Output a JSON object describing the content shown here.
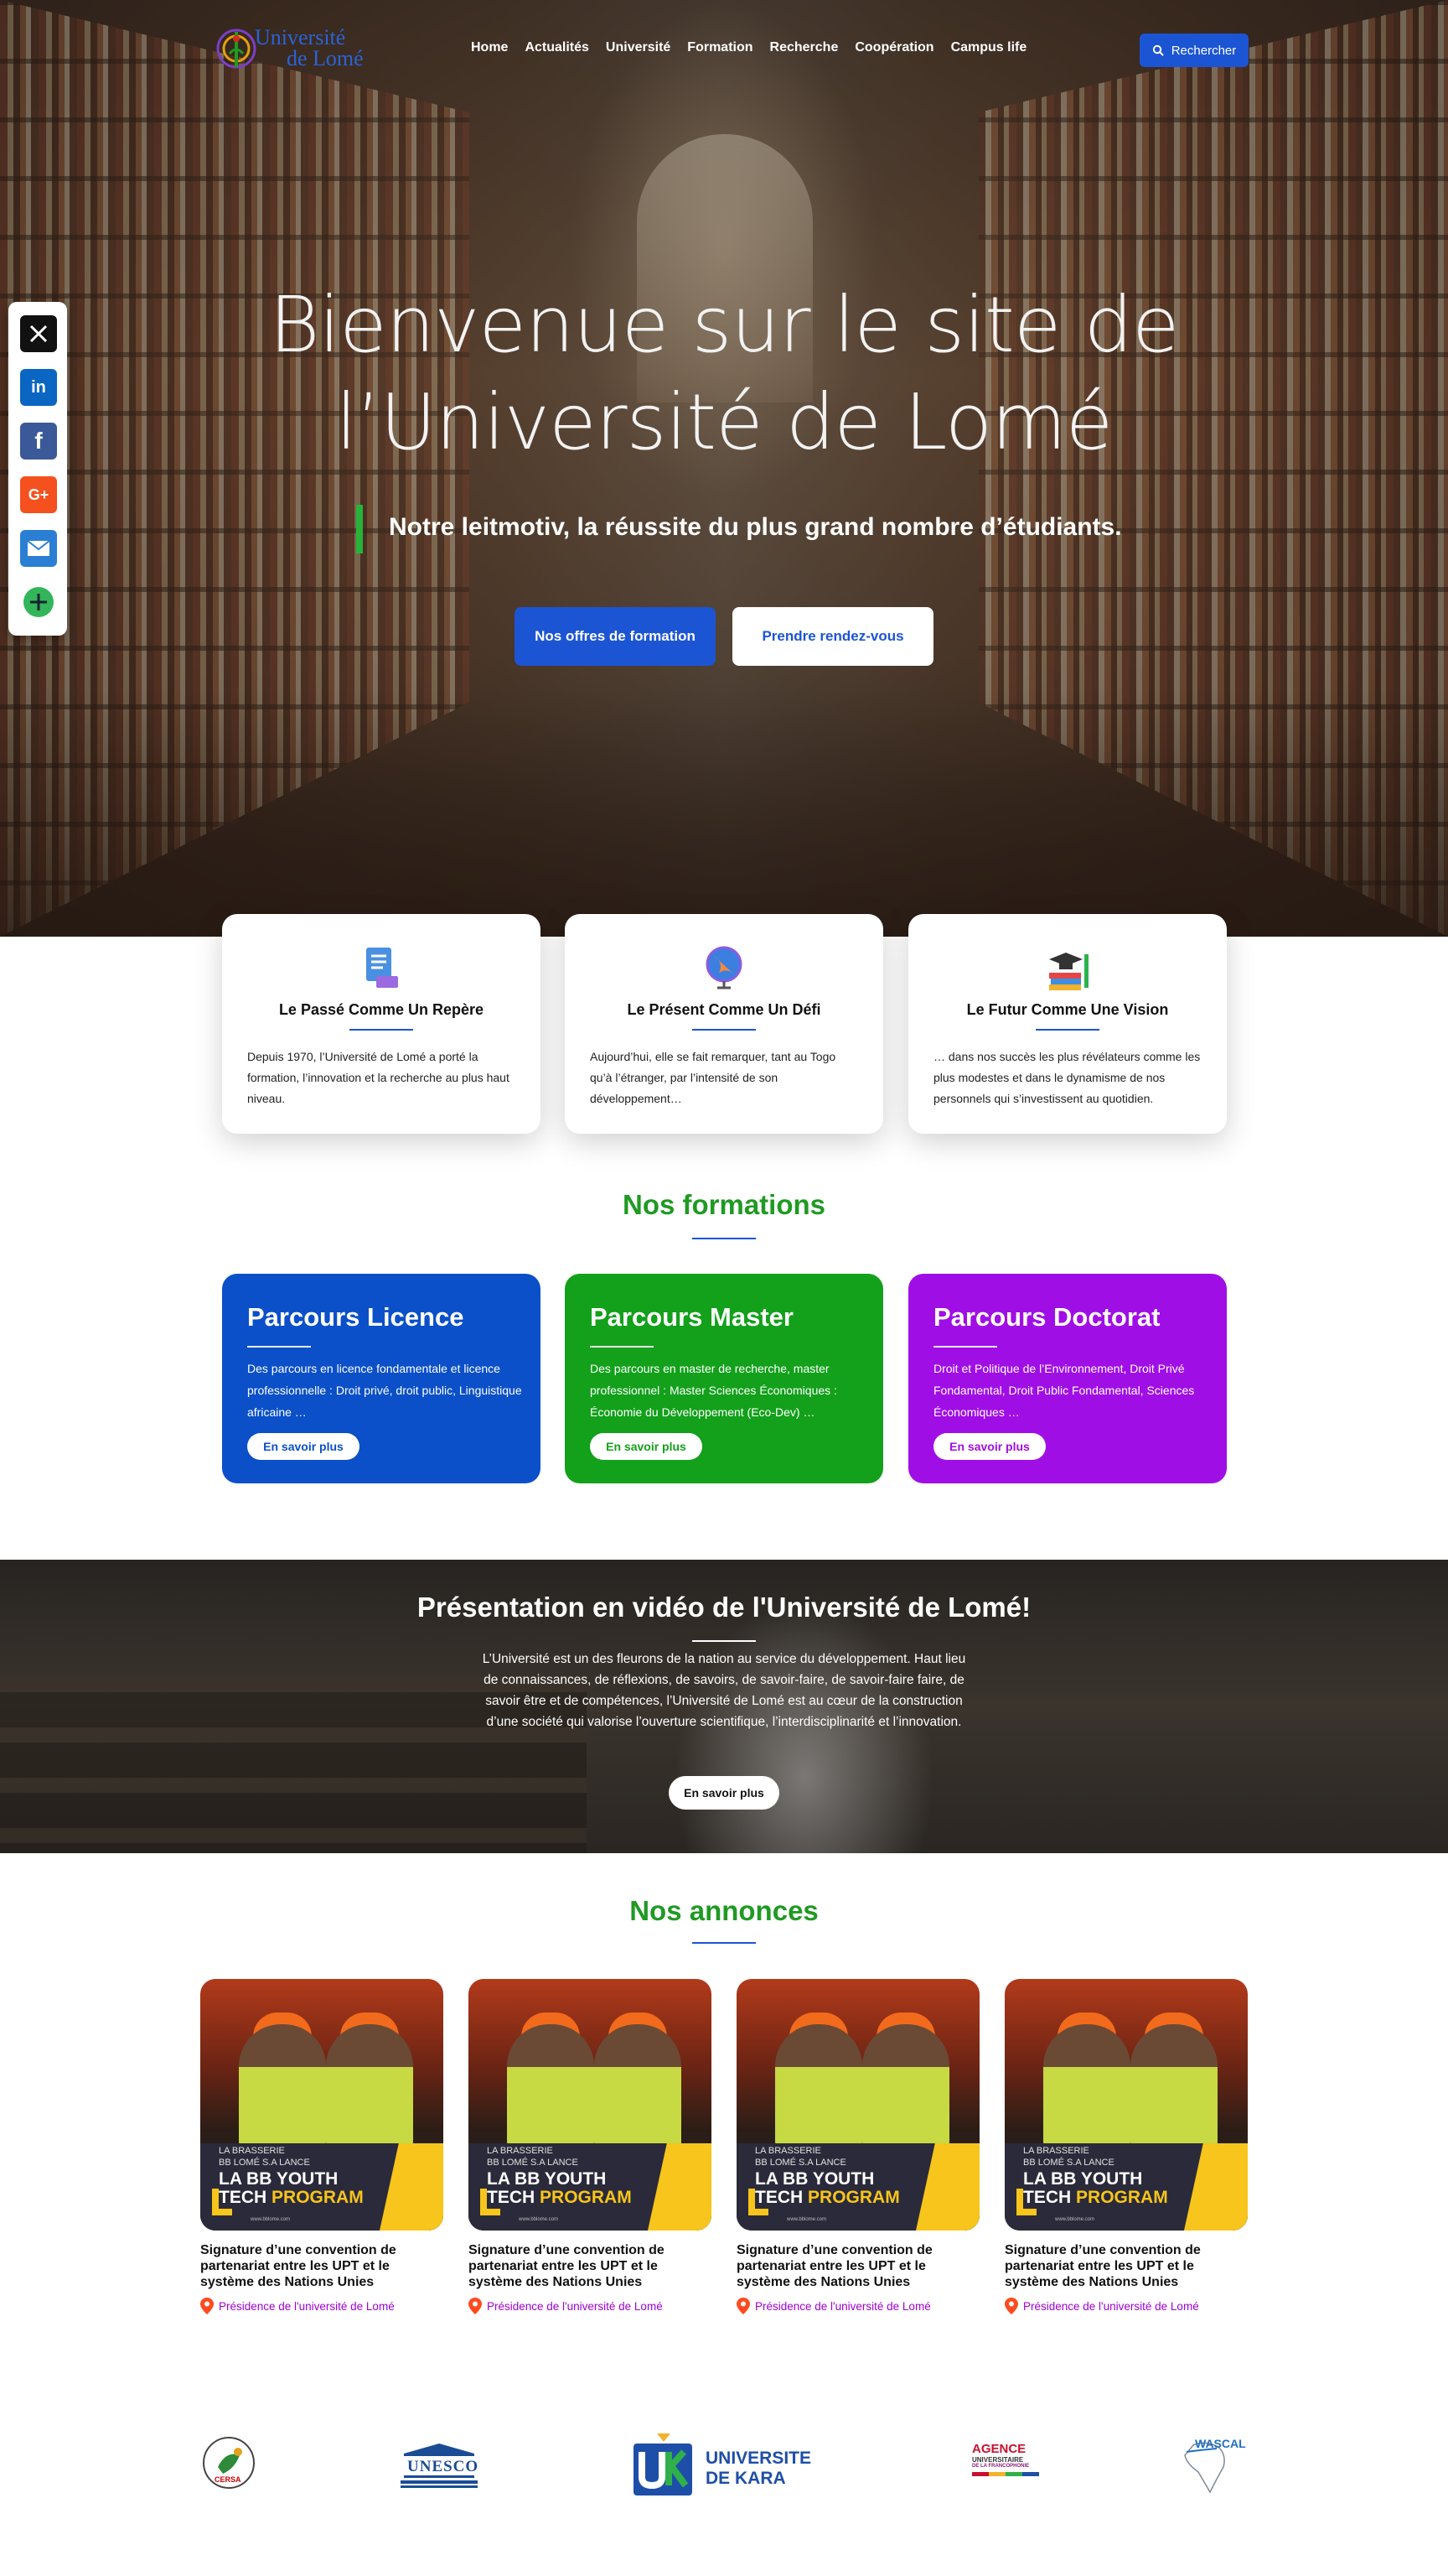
{
  "header": {
    "logo_line1": "Université",
    "logo_line2": "de Lomé",
    "nav": [
      "Home",
      "Actualités",
      "Université",
      "Formation",
      "Recherche",
      "Coopération",
      "Campus life"
    ],
    "search_label": "Rechercher"
  },
  "hero": {
    "title_line1": "Bienvenue sur le site de",
    "title_line2": "l’Université de Lomé",
    "motto": "Notre leitmotiv, la réussite du plus grand nombre d’étudiants.",
    "btn_primary": "Nos offres de formation",
    "btn_secondary": "Prendre rendez-vous"
  },
  "share": {
    "icons": [
      "x-icon",
      "linkedin-icon",
      "facebook-icon",
      "google-plus-icon",
      "email-icon",
      "more-icon"
    ],
    "colors": [
      "#111111",
      "#0a66c2",
      "#3b5998",
      "#f4511e",
      "#2a7fd4",
      "#33b55a"
    ]
  },
  "pillars": [
    {
      "title": "Le Passé Comme Un Repère",
      "text": "Depuis 1970, l’Université de Lomé a porté la formation, l’innovation et la recherche au plus haut niveau.",
      "icon": "document-icon"
    },
    {
      "title": "Le Présent Comme Un Défi",
      "text": "Aujourd’hui, elle se fait remarquer, tant au Togo qu’à l’étranger, par l’intensité de son développement…",
      "icon": "globe-icon"
    },
    {
      "title": "Le Futur Comme Une Vision",
      "text": "… dans nos succès les plus révélateurs comme les plus modestes et dans le dynamisme de nos personnels qui s’investissent au quotidien.",
      "icon": "graduation-books-icon"
    }
  ],
  "formations": {
    "title": "Nos formations",
    "cards": [
      {
        "title": "Parcours Licence",
        "text": "Des parcours en licence fondamentale et licence professionnelle : Droit privé, droit public, Linguistique africaine …",
        "button": "En savoir plus",
        "color": "#0b50c9"
      },
      {
        "title": "Parcours Master",
        "text": "Des parcours en master de recherche, master professionnel : Master Sciences Économiques : Économie du Développement (Eco-Dev) …",
        "button": "En savoir plus",
        "color": "#13a01b"
      },
      {
        "title": "Parcours Doctorat",
        "text": "Droit et Politique de l’Environnement, Droit Privé Fondamental, Droit Public Fondamental, Sciences Économiques …",
        "button": "En savoir plus",
        "color": "#a00ee6"
      }
    ]
  },
  "video": {
    "title": "Présentation en vidéo de l'Université de Lomé!",
    "text": "L’Université est un des fleurons de la nation au service du  développement. Haut lieu de connaissances, de réflexions, de savoirs, de savoir-faire, de savoir-faire faire, de savoir être et de compétences, l’Université de Lomé est au cœur de la construction d’une société qui valorise l’ouverture scientifique, l’interdisciplinarité et l’innovation.",
    "button": "En savoir plus"
  },
  "annonces": {
    "title": "Nos annonces",
    "items": [
      {
        "poster_top": "LA BRASSERIE\nBB LOMÉ S.A LANCE",
        "poster_main": "LA BB YOUTH",
        "poster_main2": "TECH",
        "poster_accent": "PROGRAM",
        "poster_url": "www.bblome.com",
        "title": "Signature d’une convention de partenariat entre les UPT et le système des Nations Unies",
        "location": "Présidence de l'université de Lomé"
      },
      {
        "poster_top": "LA BRASSERIE\nBB LOMÉ S.A LANCE",
        "poster_main": "LA BB YOUTH",
        "poster_main2": "TECH",
        "poster_accent": "PROGRAM",
        "poster_url": "www.bblome.com",
        "title": "Signature d’une convention de partenariat entre les UPT et le système des Nations Unies",
        "location": "Présidence de l'université de Lomé"
      },
      {
        "poster_top": "LA BRASSERIE\nBB LOMÉ S.A LANCE",
        "poster_main": "LA BB YOUTH",
        "poster_main2": "TECH",
        "poster_accent": "PROGRAM",
        "poster_url": "www.bblome.com",
        "title": "Signature d’une convention de partenariat entre les UPT et le système des Nations Unies",
        "location": "Présidence de l'université de Lomé"
      },
      {
        "poster_top": "LA BRASSERIE\nBB LOMÉ S.A LANCE",
        "poster_main": "LA BB YOUTH",
        "poster_main2": "TECH",
        "poster_accent": "PROGRAM",
        "poster_url": "www.bblome.com",
        "title": "Signature d’une convention de partenariat entre les UPT et le système des Nations Unies",
        "location": "Présidence de l'université de Lomé"
      }
    ]
  },
  "partners": {
    "cersa": "CERSA",
    "unesco": "UNESCO",
    "kara_line1": "UNIVERSITE",
    "kara_line2": "DE KARA",
    "agence_line1": "AGENCE",
    "agence_line2": "UNIVERSITAIRE",
    "agence_line3": "DE LA FRANCOPHONIE",
    "wascal": "WASCAL"
  },
  "colors": {
    "accent_blue": "#1c55d4",
    "green": "#1f9a23",
    "purple": "#a000d6"
  }
}
